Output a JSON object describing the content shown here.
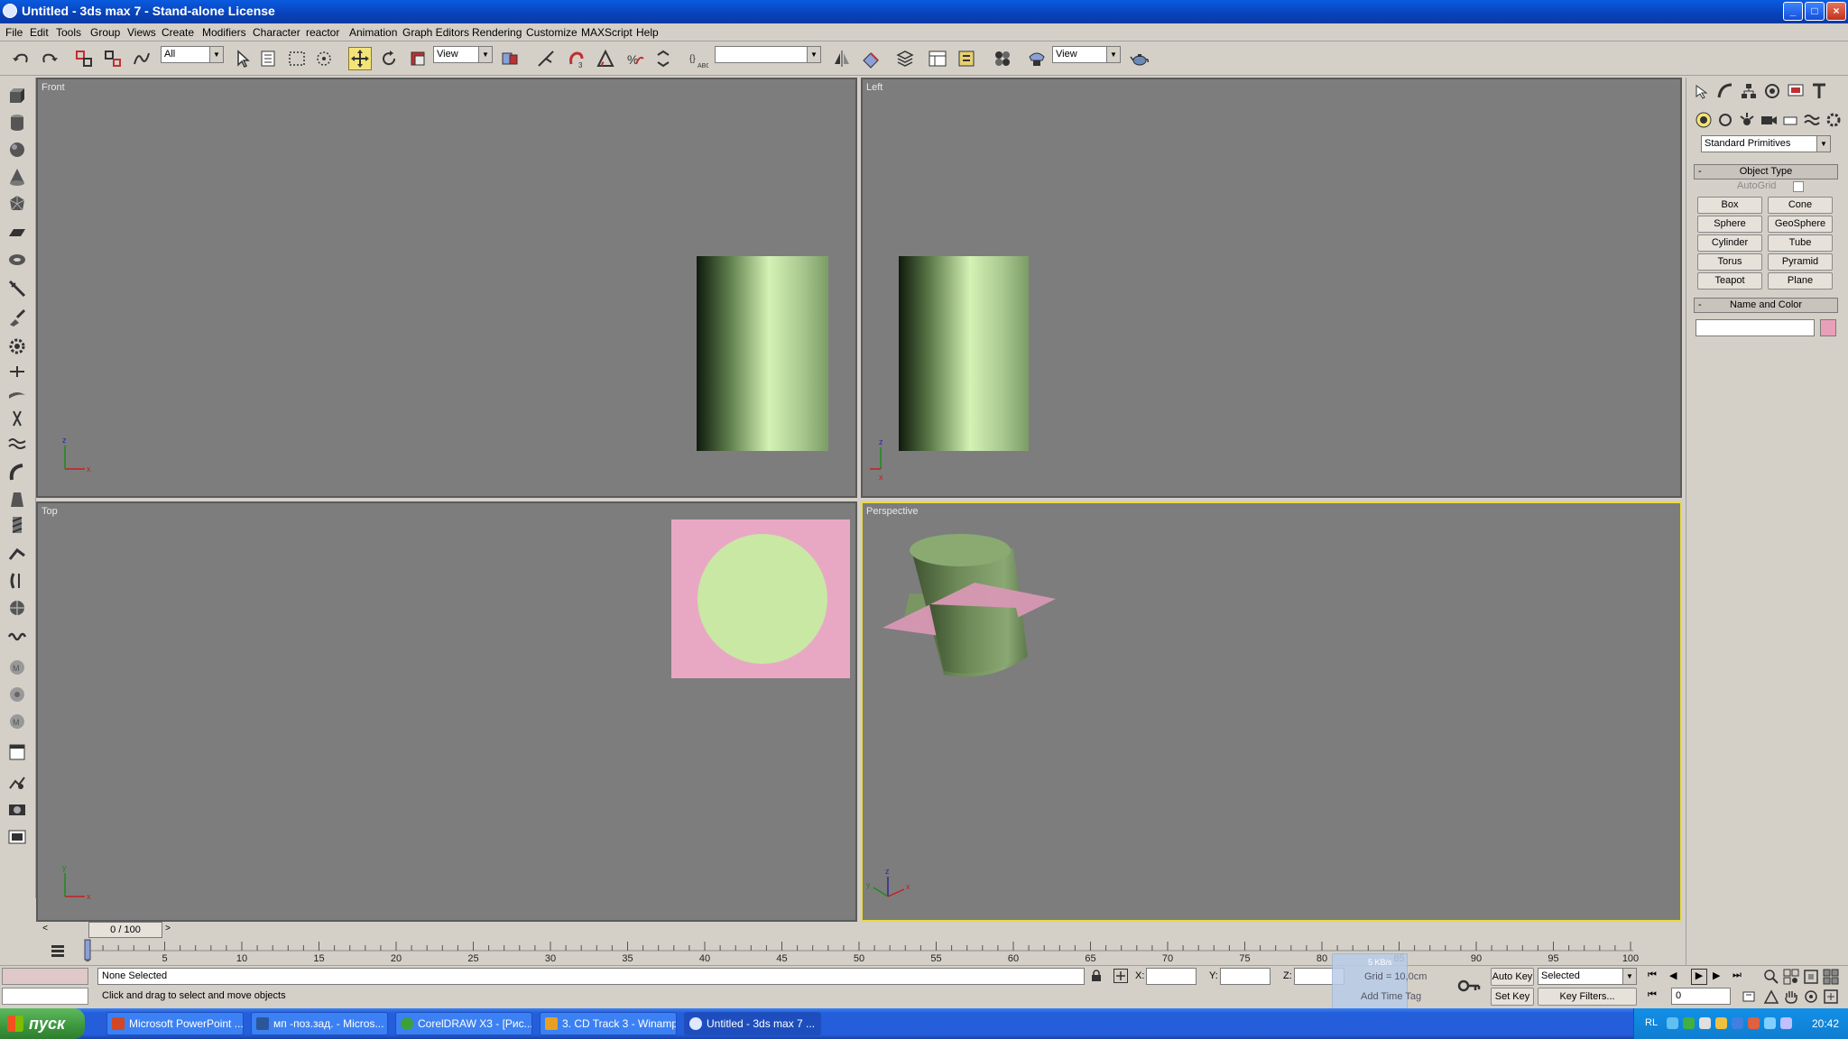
{
  "window": {
    "title": "Untitled - 3ds max 7 - Stand-alone License",
    "controls": [
      "_",
      "□",
      "×"
    ]
  },
  "menubar": [
    "File",
    "Edit",
    "Tools",
    "Group",
    "Views",
    "Create",
    "Modifiers",
    "Character",
    "reactor",
    "Animation",
    "Graph Editors",
    "Rendering",
    "Customize",
    "MAXScript",
    "Help"
  ],
  "toolbar": {
    "selection_filter": "All",
    "ref_coord_1": "View",
    "named_selection": "",
    "ref_coord_2": "View",
    "active_tool": "select-and-move"
  },
  "viewports": {
    "front": {
      "label": "Front"
    },
    "left": {
      "label": "Left"
    },
    "top": {
      "label": "Top"
    },
    "perspective": {
      "label": "Perspective",
      "active": true
    }
  },
  "axes": {
    "x": "x",
    "y": "y",
    "z": "z"
  },
  "scene_colors": {
    "cylinder": "#b8dc9c",
    "plane": "#e8a8c4",
    "viewport_bg": "#7d7d7d",
    "active_border": "#e8dc3c"
  },
  "command_panel": {
    "category": "Standard Primitives",
    "object_type_header": "Object Type",
    "autogrid": "AutoGrid",
    "buttons": [
      "Box",
      "Cone",
      "Sphere",
      "GeoSphere",
      "Cylinder",
      "Tube",
      "Torus",
      "Pyramid",
      "Teapot",
      "Plane"
    ],
    "name_color_header": "Name and Color",
    "name_value": "",
    "swatch_color": "#e8a0b8"
  },
  "timeline": {
    "frame_counter": "0 / 100",
    "ticks": [
      "0",
      "5",
      "10",
      "15",
      "20",
      "25",
      "30",
      "35",
      "40",
      "45",
      "50",
      "55",
      "60",
      "65",
      "70",
      "75",
      "80",
      "85",
      "90",
      "95",
      "100"
    ]
  },
  "status": {
    "selection": "None Selected",
    "prompt": "Click and drag to select and move objects",
    "x_label": "X:",
    "y_label": "Y:",
    "z_label": "Z:",
    "x_value": "",
    "y_value": "",
    "z_value": "",
    "grid": "Grid = 10,0cm",
    "add_time_tag": "Add Time Tag",
    "net_speed": "5 KB/s",
    "auto_key": "Auto Key",
    "set_key": "Set Key",
    "key_mode": "Selected",
    "key_filters": "Key Filters...",
    "current_frame": "0"
  },
  "taskbar": {
    "start": "пуск",
    "tasks": [
      "Microsoft PowerPoint ...",
      "мп -поз.зад. - Micros...",
      "CorelDRAW X3 - [Рис...",
      "3. CD Track 3 - Winamp",
      "Untitled - 3ds max 7 ..."
    ],
    "lang": "RL",
    "clock": "20:42"
  }
}
